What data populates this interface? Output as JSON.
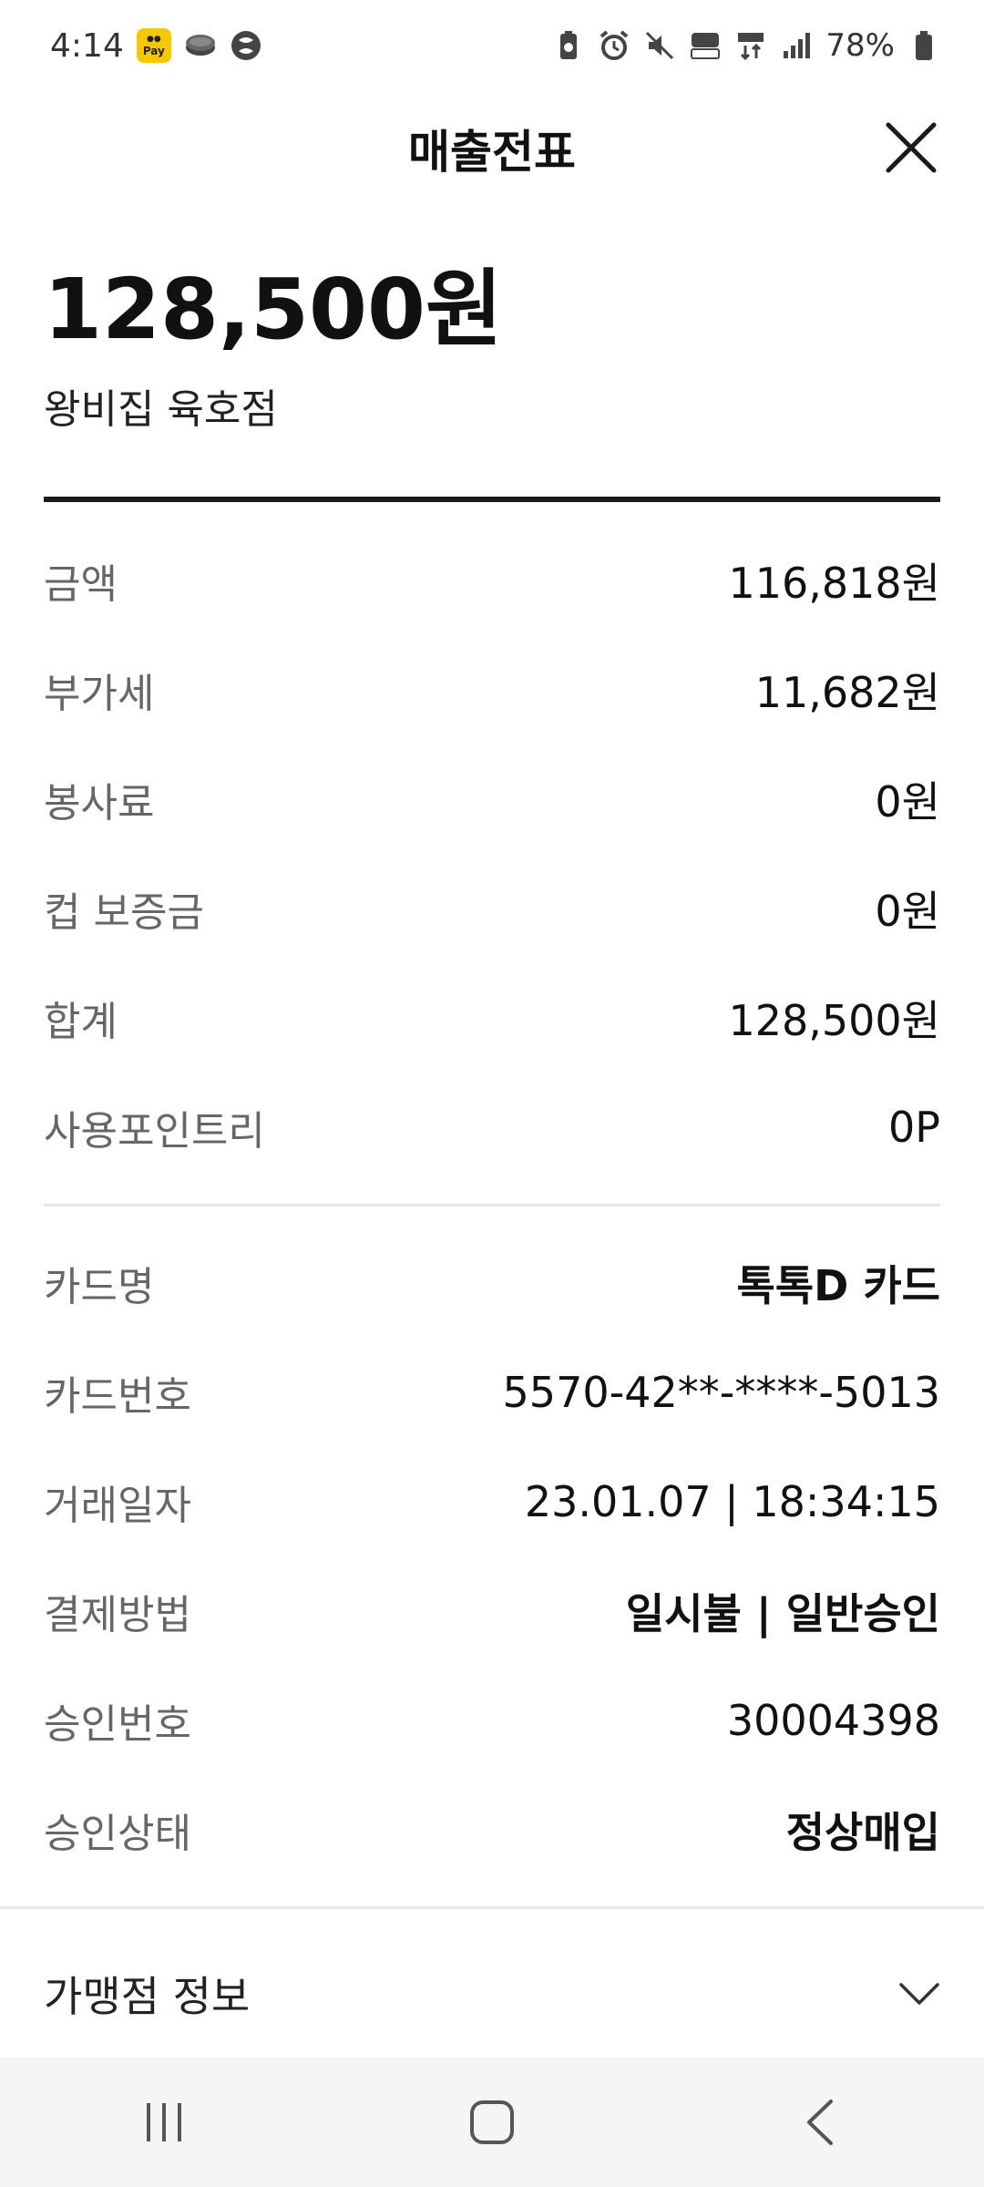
{
  "status_bar": {
    "time": "4:14",
    "pay_badge": "Pay",
    "battery": "78%"
  },
  "header": {
    "title": "매출전표"
  },
  "receipt": {
    "total": "128,500원",
    "store": "왕비집 육호점"
  },
  "amounts": [
    {
      "label": "금액",
      "value": "116,818원"
    },
    {
      "label": "부가세",
      "value": "11,682원"
    },
    {
      "label": "봉사료",
      "value": "0원"
    },
    {
      "label": "컵 보증금",
      "value": "0원"
    },
    {
      "label": "합계",
      "value": "128,500원"
    },
    {
      "label": "사용포인트리",
      "value": "0P"
    }
  ],
  "card_info": [
    {
      "label": "카드명",
      "value": "톡톡D 카드"
    },
    {
      "label": "카드번호",
      "value": "5570-42**-****-5013"
    },
    {
      "label": "거래일자",
      "value": "23.01.07 | 18:34:15"
    },
    {
      "label": "결제방법",
      "value": "일시불 | 일반승인"
    },
    {
      "label": "승인번호",
      "value": "30004398"
    },
    {
      "label": "승인상태",
      "value": "정상매입"
    }
  ],
  "merchant": {
    "label": "가맹점 정보"
  },
  "icons": {
    "close": "close-icon",
    "expand": "chevron-down-icon",
    "nav_recents": "recents-icon",
    "nav_home": "home-icon",
    "nav_back": "back-icon"
  }
}
